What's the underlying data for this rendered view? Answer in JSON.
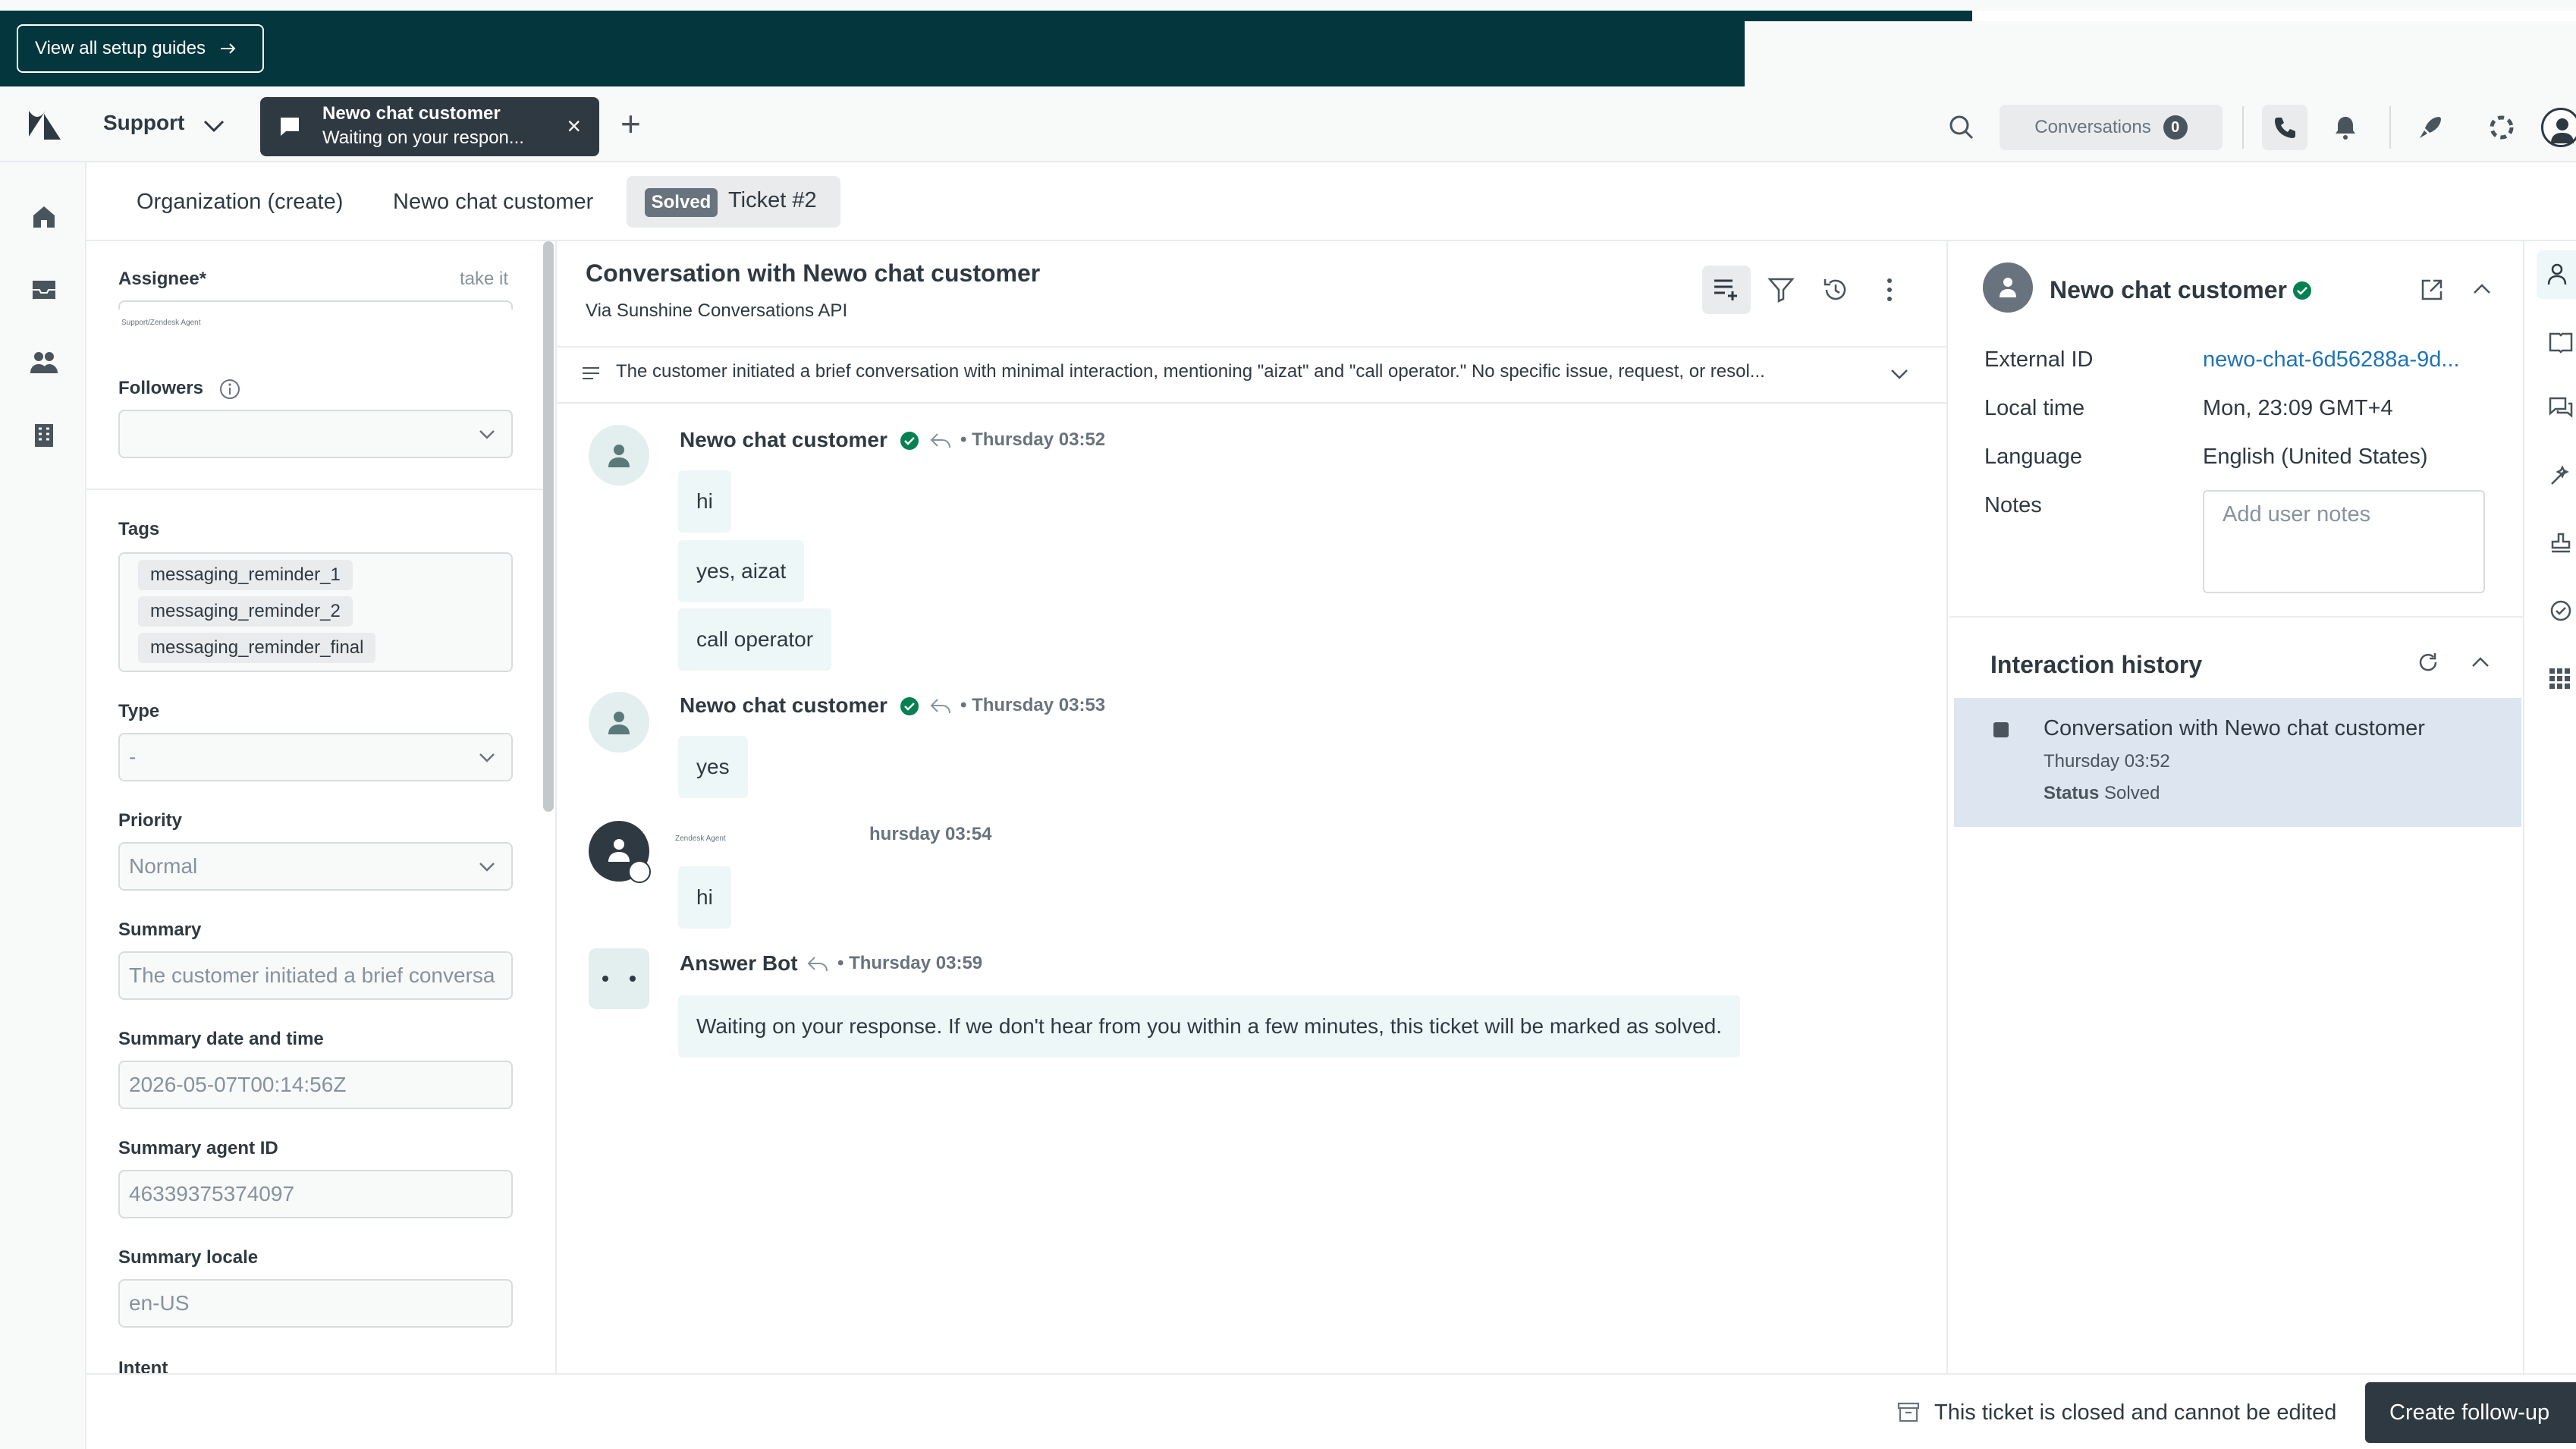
{
  "banner": {
    "setup_guides_label": "View all setup guides"
  },
  "header": {
    "product": "Support",
    "tab_popup": {
      "title": "Newo chat customer",
      "subtitle": "Waiting on your respon..."
    },
    "conversations_label": "Conversations",
    "conversations_count": "0"
  },
  "tabs": {
    "organization": "Organization (create)",
    "user": "Newo chat customer",
    "status_badge": "Solved",
    "ticket": "Ticket #2"
  },
  "properties": {
    "assignee_label": "Assignee*",
    "take_it": "take it",
    "assignee_value": "Support/Zendesk Agent",
    "followers_label": "Followers",
    "tags_label": "Tags",
    "tags": [
      "messaging_reminder_1",
      "messaging_reminder_2",
      "messaging_reminder_final"
    ],
    "type_label": "Type",
    "type_value": "-",
    "priority_label": "Priority",
    "priority_value": "Normal",
    "summary_label": "Summary",
    "summary_value": "The customer initiated a brief conversa",
    "summary_date_label": "Summary date and time",
    "summary_date_value": "2026-05-07T00:14:56Z",
    "summary_agent_label": "Summary agent ID",
    "summary_agent_value": "46339375374097",
    "summary_locale_label": "Summary locale",
    "summary_locale_value": "en-US",
    "intent_label": "Intent"
  },
  "conversation": {
    "title": "Conversation with Newo chat customer",
    "via": "Via Sunshine Conversations API",
    "summary": "The customer initiated a brief conversation with minimal interaction, mentioning \"aizat\" and \"call operator.\" No specific issue, request, or resol...",
    "messages": [
      {
        "author": "Newo chat customer",
        "time": "Thursday 03:52",
        "lines": [
          "hi",
          "yes, aizat",
          "call operator"
        ]
      },
      {
        "author": "Newo chat customer",
        "time": "Thursday 03:53",
        "lines": [
          "yes"
        ]
      },
      {
        "author": "Zendesk Agent",
        "time": "hursday 03:54",
        "lines": [
          "hi"
        ]
      },
      {
        "author": "Answer Bot",
        "time": "Thursday 03:59",
        "lines": [
          "Waiting on your response. If we don't hear from you within a few minutes, this ticket will be marked as solved."
        ]
      }
    ]
  },
  "footer": {
    "closed_text": "This ticket is closed and cannot be edited",
    "followup_label": "Create follow-up"
  },
  "user_panel": {
    "name": "Newo chat customer",
    "external_id_label": "External ID",
    "external_id_value": "newo-chat-6d56288a-9d...",
    "local_time_label": "Local time",
    "local_time_value": "Mon, 23:09 GMT+4",
    "language_label": "Language",
    "language_value": "English (United States)",
    "notes_label": "Notes",
    "notes_placeholder": "Add user notes"
  },
  "interaction_history": {
    "title": "Interaction history",
    "item_title": "Conversation with Newo chat customer",
    "item_time": "Thursday 03:52",
    "item_status_label": "Status",
    "item_status_value": "Solved"
  },
  "colors": {
    "banner": "#03363d",
    "text": "#2f3941",
    "link": "#1f73b7",
    "verified": "#038153",
    "bubble": "#edf7f7",
    "selected_history": "#dde6f0"
  }
}
